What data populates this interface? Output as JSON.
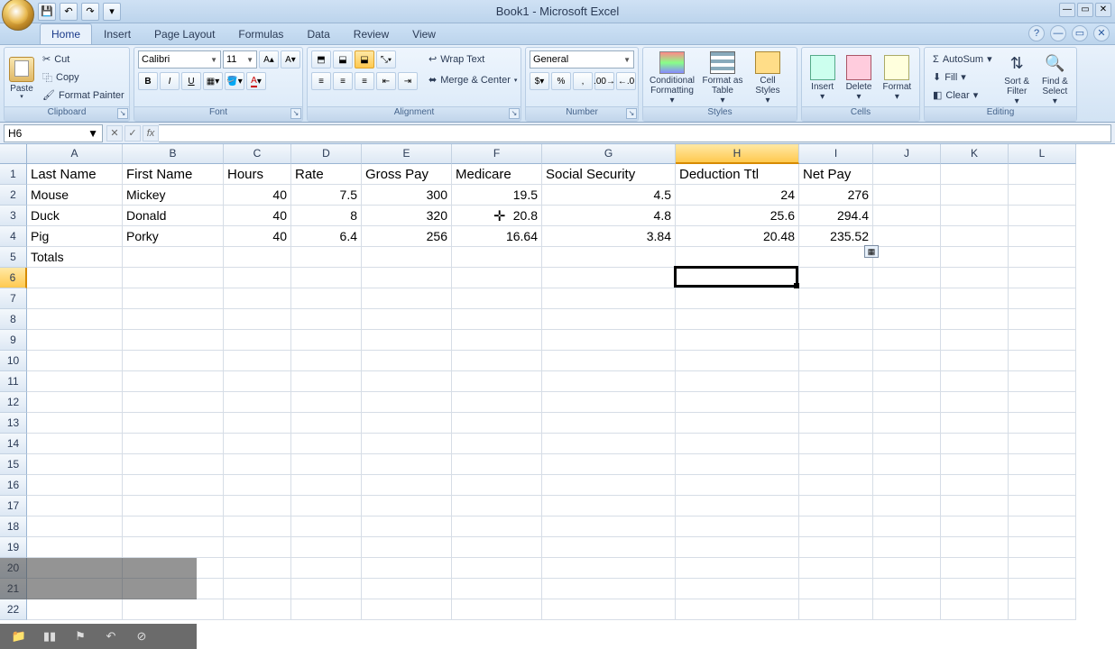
{
  "app": {
    "title": "Book1 - Microsoft Excel"
  },
  "qat": {
    "save": "💾",
    "undo": "↶",
    "redo": "↷",
    "custom": "▾"
  },
  "win": {
    "min": "—",
    "max": "▭",
    "close": "✕"
  },
  "help": {
    "q": "?",
    "min": "—",
    "restore": "▭",
    "close": "✕"
  },
  "tabs": [
    "Home",
    "Insert",
    "Page Layout",
    "Formulas",
    "Data",
    "Review",
    "View"
  ],
  "active_tab": 0,
  "ribbon": {
    "clipboard": {
      "label": "Clipboard",
      "paste": "Paste",
      "cut": "Cut",
      "copy": "Copy",
      "fp": "Format Painter"
    },
    "font": {
      "label": "Font",
      "name": "Calibri",
      "size": "11"
    },
    "alignment": {
      "label": "Alignment",
      "wrap": "Wrap Text",
      "merge": "Merge & Center"
    },
    "number": {
      "label": "Number",
      "format": "General"
    },
    "styles": {
      "label": "Styles",
      "cf": "Conditional Formatting",
      "fat": "Format as Table",
      "cs": "Cell Styles"
    },
    "cells": {
      "label": "Cells",
      "ins": "Insert",
      "del": "Delete",
      "fmt": "Format"
    },
    "editing": {
      "label": "Editing",
      "sum": "AutoSum",
      "fill": "Fill",
      "clear": "Clear",
      "sort": "Sort & Filter",
      "find": "Find & Select"
    }
  },
  "namebox": "H6",
  "columns": [
    {
      "letter": "A",
      "width": 106
    },
    {
      "letter": "B",
      "width": 112
    },
    {
      "letter": "C",
      "width": 75
    },
    {
      "letter": "D",
      "width": 78
    },
    {
      "letter": "E",
      "width": 100
    },
    {
      "letter": "F",
      "width": 100
    },
    {
      "letter": "G",
      "width": 148
    },
    {
      "letter": "H",
      "width": 137
    },
    {
      "letter": "I",
      "width": 82
    },
    {
      "letter": "J",
      "width": 75
    },
    {
      "letter": "K",
      "width": 75
    },
    {
      "letter": "L",
      "width": 75
    }
  ],
  "selected_col": 7,
  "selected_row": 5,
  "rows": 22,
  "data": {
    "headers": [
      "Last Name",
      "First Name",
      "Hours",
      "Rate",
      "Gross Pay",
      "Medicare",
      "Social Security",
      "Deduction Ttl",
      "Net Pay"
    ],
    "records": [
      {
        "last": "Mouse",
        "first": "Mickey",
        "hours": 40,
        "rate": 7.5,
        "gross": 300,
        "med": 19.5,
        "ss": 4.5,
        "ded": 24,
        "net": 276
      },
      {
        "last": "Duck",
        "first": "Donald",
        "hours": 40,
        "rate": 8,
        "gross": 320,
        "med": 20.8,
        "ss": 4.8,
        "ded": 25.6,
        "net": 294.4
      },
      {
        "last": "Pig",
        "first": "Porky",
        "hours": 40,
        "rate": 6.4,
        "gross": 256,
        "med": 16.64,
        "ss": 3.84,
        "ded": 20.48,
        "net": 235.52
      }
    ],
    "totals_label": "Totals"
  },
  "chart_data": {
    "type": "table",
    "headers": [
      "Last Name",
      "First Name",
      "Hours",
      "Rate",
      "Gross Pay",
      "Medicare",
      "Social Security",
      "Deduction Ttl",
      "Net Pay"
    ],
    "rows": [
      [
        "Mouse",
        "Mickey",
        40,
        7.5,
        300,
        19.5,
        4.5,
        24,
        276
      ],
      [
        "Duck",
        "Donald",
        40,
        8,
        320,
        20.8,
        4.8,
        25.6,
        294.4
      ],
      [
        "Pig",
        "Porky",
        40,
        6.4,
        256,
        16.64,
        3.84,
        20.48,
        235.52
      ]
    ]
  },
  "recorder": {
    "play": "▮▮",
    "flag": "⚑",
    "undo": "↶",
    "stop": "⊘",
    "folder": "📁"
  }
}
